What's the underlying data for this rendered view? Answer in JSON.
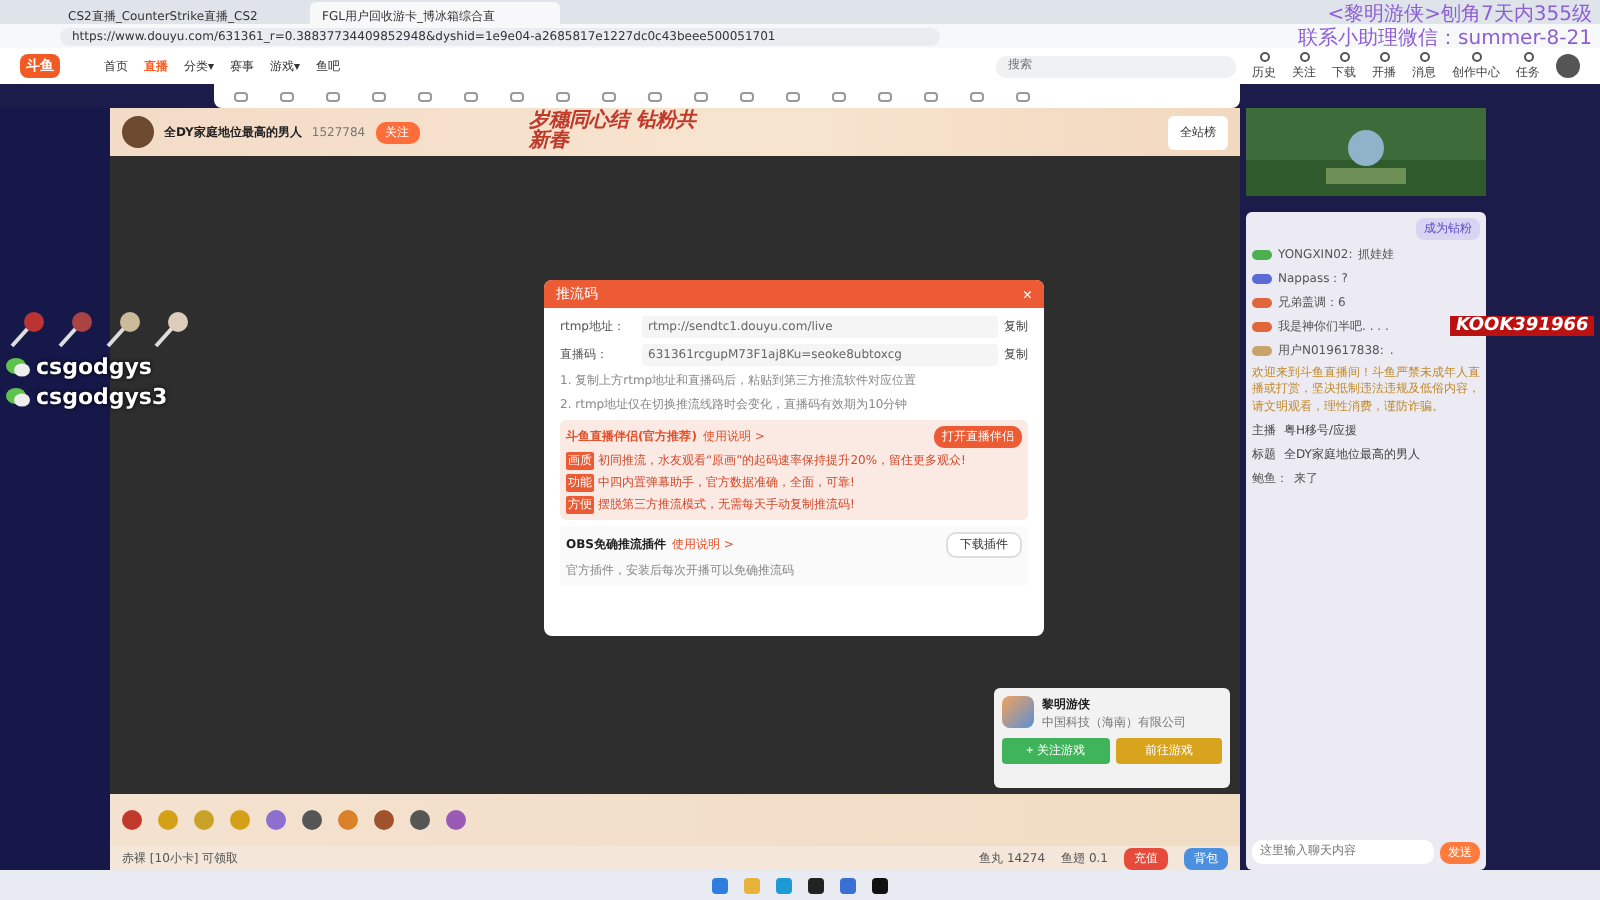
{
  "browser": {
    "tabs": [
      {
        "title": "CS2直播_CounterStrike直播_CS2",
        "selected": false
      },
      {
        "title": "FGL用户回收游卡_博冰箱综合直",
        "selected": true
      }
    ],
    "url": "https://www.douyu.com/631361_r=0.38837734409852948&dyshid=1e9e04-a2685817e1227dc0c43beee500051701"
  },
  "overlay_text": [
    "<黎明游侠>刨角7天内355级",
    "联系小助理微信：summer-8-21"
  ],
  "nav": {
    "logo": "斗鱼",
    "items": [
      {
        "label": "首页",
        "selected": false
      },
      {
        "label": "直播",
        "selected": true
      },
      {
        "label": "分类▾",
        "selected": false
      },
      {
        "label": "赛事",
        "selected": false
      },
      {
        "label": "游戏▾",
        "selected": false
      },
      {
        "label": "鱼吧",
        "selected": false
      }
    ],
    "search": {
      "placeholder": "搜索"
    },
    "actions": [
      "历史",
      "关注",
      "下载",
      "开播",
      "消息",
      "创作中心",
      "任务"
    ]
  },
  "stream_overlay": {
    "contacts": [
      "csgodgys",
      "csgodgys3"
    ],
    "logo_text": "KOOK391966"
  },
  "room": {
    "title": "全DY家庭地位最高的男人",
    "follow_count": "1527784",
    "follow_button": "关注",
    "banner": "岁穗同心结 钻粉共新春",
    "banner_buttons": [
      "全站榜"
    ]
  },
  "modal": {
    "title": "推流码",
    "close": "×",
    "fields": [
      {
        "label": "rtmp地址：",
        "value": "rtmp://sendtc1.douyu.com/live",
        "action": "复制"
      },
      {
        "label": "直播码：",
        "value": "631361rcgupM73F1aj8Ku=seoke8ubtoxcg",
        "action": "复制"
      }
    ],
    "notes": [
      "1. 复制上方rtmp地址和直播码后，粘贴到第三方推流软件对应位置",
      "2. rtmp地址仅在切换推流线路时会变化，直播码有效期为10分钟"
    ],
    "companion": {
      "title": "斗鱼直播伴侣(官方推荐)",
      "link": "使用说明 >",
      "button": "打开直播伴侣",
      "lines": [
        {
          "tag": "画质",
          "text": "初同推流，水友观看“原画”的起码速率保持提升20%，留住更多观众!"
        },
        {
          "tag": "功能",
          "text": "中四内置弹幕助手，官方数据准确，全面，可靠!"
        },
        {
          "tag": "方便",
          "text": "摆脱第三方推流模式，无需每天手动复制推流码!"
        }
      ]
    },
    "plugin": {
      "title": "OBS免确推流插件",
      "link": "使用说明 >",
      "text": "官方插件，安装后每次开播可以免确推流码",
      "button": "下载插件"
    }
  },
  "chat": {
    "join_button": "成为钻粉",
    "messages": [
      {
        "user": "YONGXIN02:",
        "text": "抓娃娃",
        "color": "#4caf50"
      },
      {
        "text": "Nappass：?",
        "color": "#5b6bd6"
      },
      {
        "text": "兄弟盖调：6",
        "color": "#e0663c"
      },
      {
        "text": "我是神你们半吧. . . .",
        "color": "#e0663c"
      },
      {
        "user": "用户N019617838:",
        "text": ".",
        "color": "#c9a46a"
      }
    ],
    "notice": "欢迎来到斗鱼直播间！斗鱼严禁未成年人直播或打赏，坚决抵制违法违规及低俗内容，请文明观看，理性消费，谨防诈骗。",
    "info": [
      {
        "label": "主播",
        "value": "粤H移号/应援"
      },
      {
        "label": "标题",
        "value": "全DY家庭地位最高的男人"
      }
    ],
    "last": {
      "user": "鲍鱼：",
      "text": "来了"
    },
    "input": {
      "placeholder": "这里输入聊天内容"
    },
    "send": "发送"
  },
  "ad": {
    "name": "黎明游侠",
    "company": "中国科技（海南）有限公司",
    "buttons": [
      {
        "label": "+ 关注游戏",
        "kind": "green"
      },
      {
        "label": "前往游戏",
        "kind": "gold"
      }
    ]
  },
  "status": {
    "left": "赤裸 [10小卡] 可领取",
    "fishball": "鱼丸 14274",
    "fin": "鱼翅 0.1",
    "recharge": "充值",
    "bag": "背包"
  }
}
